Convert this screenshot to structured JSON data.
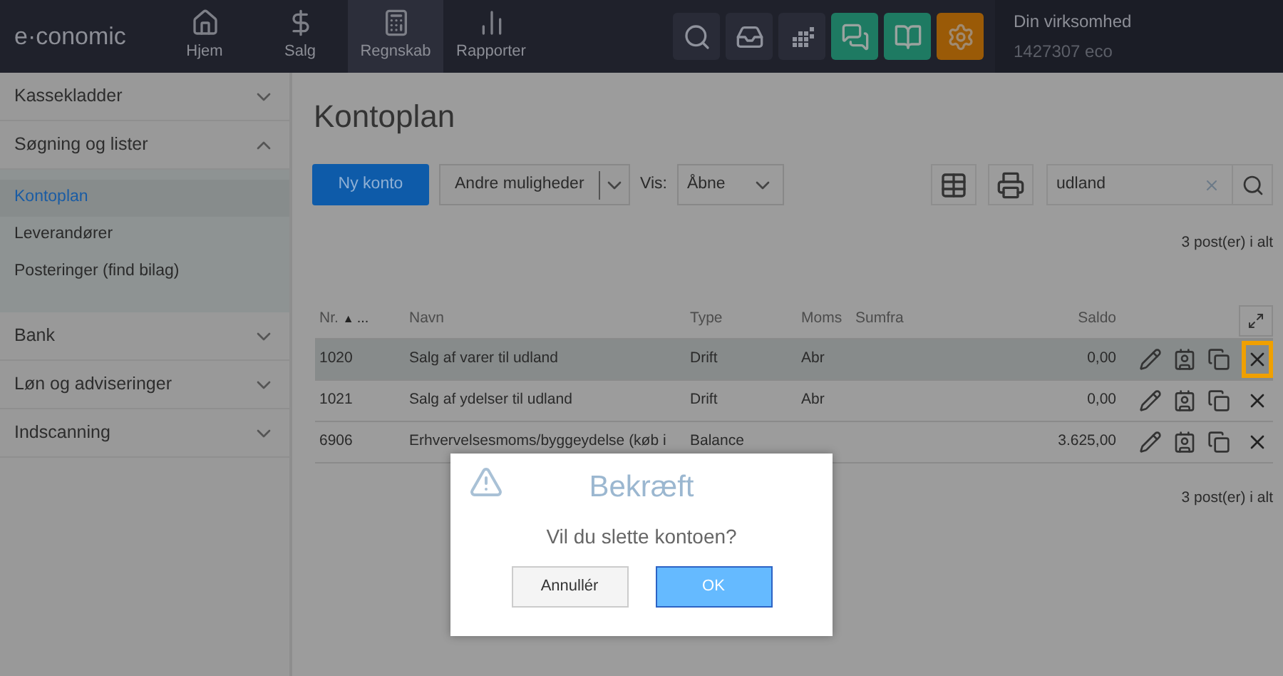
{
  "logo": "e·conomic",
  "nav": [
    {
      "label": "Hjem",
      "kind": "home",
      "selected": false
    },
    {
      "label": "Salg",
      "kind": "dollar",
      "selected": false
    },
    {
      "label": "Regnskab",
      "kind": "calculator",
      "selected": true
    },
    {
      "label": "Rapporter",
      "kind": "chart",
      "selected": false
    }
  ],
  "tools": [
    {
      "kind": "search",
      "color": "#292b37"
    },
    {
      "kind": "inbox",
      "color": "#292b37"
    },
    {
      "kind": "dots",
      "color": "#292b37"
    },
    {
      "kind": "chat",
      "color": "#1e7a62"
    },
    {
      "kind": "book",
      "color": "#1e7a62"
    },
    {
      "kind": "gear",
      "color": "#9a5a07"
    }
  ],
  "account": {
    "company": "Din virksomhed",
    "id": "1427307 eco"
  },
  "sidebar": [
    {
      "label": "Kassekladder",
      "expanded": false
    },
    {
      "label": "Søgning og lister",
      "expanded": true,
      "children": [
        {
          "label": "Kontoplan",
          "selected": true
        },
        {
          "label": "Leverandører",
          "selected": false
        },
        {
          "label": "Posteringer (find bilag)",
          "selected": false
        }
      ]
    },
    {
      "label": "Bank",
      "expanded": false
    },
    {
      "label": "Løn og adviseringer",
      "expanded": false
    },
    {
      "label": "Indscanning",
      "expanded": false
    }
  ],
  "title": "Kontoplan",
  "toolbar": {
    "new_button": "Ny konto",
    "more_button": "Andre muligheder",
    "view_label": "Vis:",
    "view_value": "Åbne",
    "search_value": "udland"
  },
  "count_top": "3 post(er) i alt",
  "table": {
    "columns": [
      "Nr.",
      "Navn",
      "Type",
      "Moms",
      "Sumfra",
      "Saldo"
    ],
    "sort_mark": "▲",
    "sort_more": "...",
    "rows": [
      {
        "cells": [
          "1020",
          "Salg af varer til udland",
          "Drift",
          "Abr",
          "",
          "0,00"
        ],
        "selected": true,
        "delete_highlighted": true
      },
      {
        "cells": [
          "1021",
          "Salg af ydelser til udland",
          "Drift",
          "Abr",
          "",
          "0,00"
        ],
        "selected": false,
        "delete_highlighted": false
      },
      {
        "cells": [
          "6906",
          "Erhvervelsesmoms/byggeydelse (køb i",
          "Balance",
          "",
          "",
          "3.625,00"
        ],
        "selected": false,
        "delete_highlighted": false
      }
    ]
  },
  "count_bottom": "3 post(er) i alt",
  "dialog": {
    "title": "Bekræft",
    "message": "Vil du slette kontoen?",
    "cancel": "Annullér",
    "ok": "OK"
  }
}
